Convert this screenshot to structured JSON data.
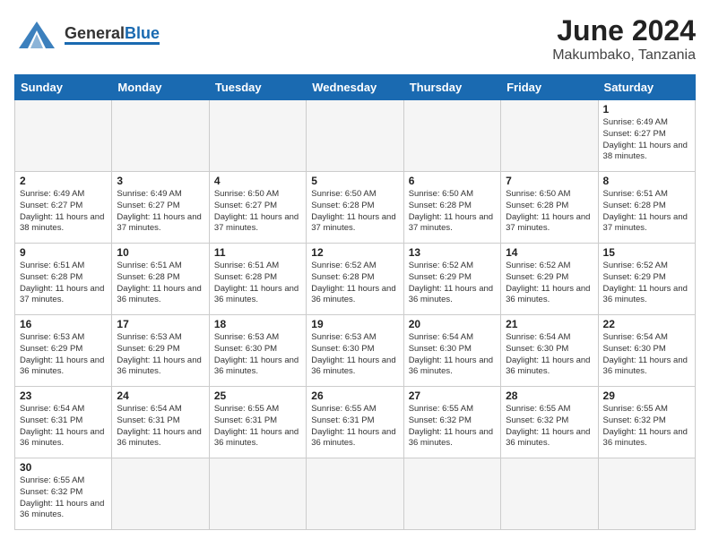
{
  "header": {
    "logo_general": "General",
    "logo_blue": "Blue",
    "main_title": "June 2024",
    "sub_title": "Makumbako, Tanzania"
  },
  "days_of_week": [
    "Sunday",
    "Monday",
    "Tuesday",
    "Wednesday",
    "Thursday",
    "Friday",
    "Saturday"
  ],
  "weeks": [
    [
      {
        "day": "",
        "empty": true
      },
      {
        "day": "",
        "empty": true
      },
      {
        "day": "",
        "empty": true
      },
      {
        "day": "",
        "empty": true
      },
      {
        "day": "",
        "empty": true
      },
      {
        "day": "",
        "empty": true
      },
      {
        "day": "1",
        "sunrise": "6:49 AM",
        "sunset": "6:27 PM",
        "daylight": "11 hours and 38 minutes."
      }
    ],
    [
      {
        "day": "2",
        "sunrise": "6:49 AM",
        "sunset": "6:27 PM",
        "daylight": "11 hours and 38 minutes."
      },
      {
        "day": "3",
        "sunrise": "6:49 AM",
        "sunset": "6:27 PM",
        "daylight": "11 hours and 37 minutes."
      },
      {
        "day": "4",
        "sunrise": "6:50 AM",
        "sunset": "6:27 PM",
        "daylight": "11 hours and 37 minutes."
      },
      {
        "day": "5",
        "sunrise": "6:50 AM",
        "sunset": "6:28 PM",
        "daylight": "11 hours and 37 minutes."
      },
      {
        "day": "6",
        "sunrise": "6:50 AM",
        "sunset": "6:28 PM",
        "daylight": "11 hours and 37 minutes."
      },
      {
        "day": "7",
        "sunrise": "6:50 AM",
        "sunset": "6:28 PM",
        "daylight": "11 hours and 37 minutes."
      },
      {
        "day": "8",
        "sunrise": "6:51 AM",
        "sunset": "6:28 PM",
        "daylight": "11 hours and 37 minutes."
      }
    ],
    [
      {
        "day": "9",
        "sunrise": "6:51 AM",
        "sunset": "6:28 PM",
        "daylight": "11 hours and 37 minutes."
      },
      {
        "day": "10",
        "sunrise": "6:51 AM",
        "sunset": "6:28 PM",
        "daylight": "11 hours and 36 minutes."
      },
      {
        "day": "11",
        "sunrise": "6:51 AM",
        "sunset": "6:28 PM",
        "daylight": "11 hours and 36 minutes."
      },
      {
        "day": "12",
        "sunrise": "6:52 AM",
        "sunset": "6:28 PM",
        "daylight": "11 hours and 36 minutes."
      },
      {
        "day": "13",
        "sunrise": "6:52 AM",
        "sunset": "6:29 PM",
        "daylight": "11 hours and 36 minutes."
      },
      {
        "day": "14",
        "sunrise": "6:52 AM",
        "sunset": "6:29 PM",
        "daylight": "11 hours and 36 minutes."
      },
      {
        "day": "15",
        "sunrise": "6:52 AM",
        "sunset": "6:29 PM",
        "daylight": "11 hours and 36 minutes."
      }
    ],
    [
      {
        "day": "16",
        "sunrise": "6:53 AM",
        "sunset": "6:29 PM",
        "daylight": "11 hours and 36 minutes."
      },
      {
        "day": "17",
        "sunrise": "6:53 AM",
        "sunset": "6:29 PM",
        "daylight": "11 hours and 36 minutes."
      },
      {
        "day": "18",
        "sunrise": "6:53 AM",
        "sunset": "6:30 PM",
        "daylight": "11 hours and 36 minutes."
      },
      {
        "day": "19",
        "sunrise": "6:53 AM",
        "sunset": "6:30 PM",
        "daylight": "11 hours and 36 minutes."
      },
      {
        "day": "20",
        "sunrise": "6:54 AM",
        "sunset": "6:30 PM",
        "daylight": "11 hours and 36 minutes."
      },
      {
        "day": "21",
        "sunrise": "6:54 AM",
        "sunset": "6:30 PM",
        "daylight": "11 hours and 36 minutes."
      },
      {
        "day": "22",
        "sunrise": "6:54 AM",
        "sunset": "6:30 PM",
        "daylight": "11 hours and 36 minutes."
      }
    ],
    [
      {
        "day": "23",
        "sunrise": "6:54 AM",
        "sunset": "6:31 PM",
        "daylight": "11 hours and 36 minutes."
      },
      {
        "day": "24",
        "sunrise": "6:54 AM",
        "sunset": "6:31 PM",
        "daylight": "11 hours and 36 minutes."
      },
      {
        "day": "25",
        "sunrise": "6:55 AM",
        "sunset": "6:31 PM",
        "daylight": "11 hours and 36 minutes."
      },
      {
        "day": "26",
        "sunrise": "6:55 AM",
        "sunset": "6:31 PM",
        "daylight": "11 hours and 36 minutes."
      },
      {
        "day": "27",
        "sunrise": "6:55 AM",
        "sunset": "6:32 PM",
        "daylight": "11 hours and 36 minutes."
      },
      {
        "day": "28",
        "sunrise": "6:55 AM",
        "sunset": "6:32 PM",
        "daylight": "11 hours and 36 minutes."
      },
      {
        "day": "29",
        "sunrise": "6:55 AM",
        "sunset": "6:32 PM",
        "daylight": "11 hours and 36 minutes."
      }
    ],
    [
      {
        "day": "30",
        "sunrise": "6:55 AM",
        "sunset": "6:32 PM",
        "daylight": "11 hours and 36 minutes."
      },
      {
        "day": "",
        "empty": true
      },
      {
        "day": "",
        "empty": true
      },
      {
        "day": "",
        "empty": true
      },
      {
        "day": "",
        "empty": true
      },
      {
        "day": "",
        "empty": true
      },
      {
        "day": "",
        "empty": true
      }
    ]
  ],
  "labels": {
    "sunrise": "Sunrise:",
    "sunset": "Sunset:",
    "daylight": "Daylight:"
  }
}
